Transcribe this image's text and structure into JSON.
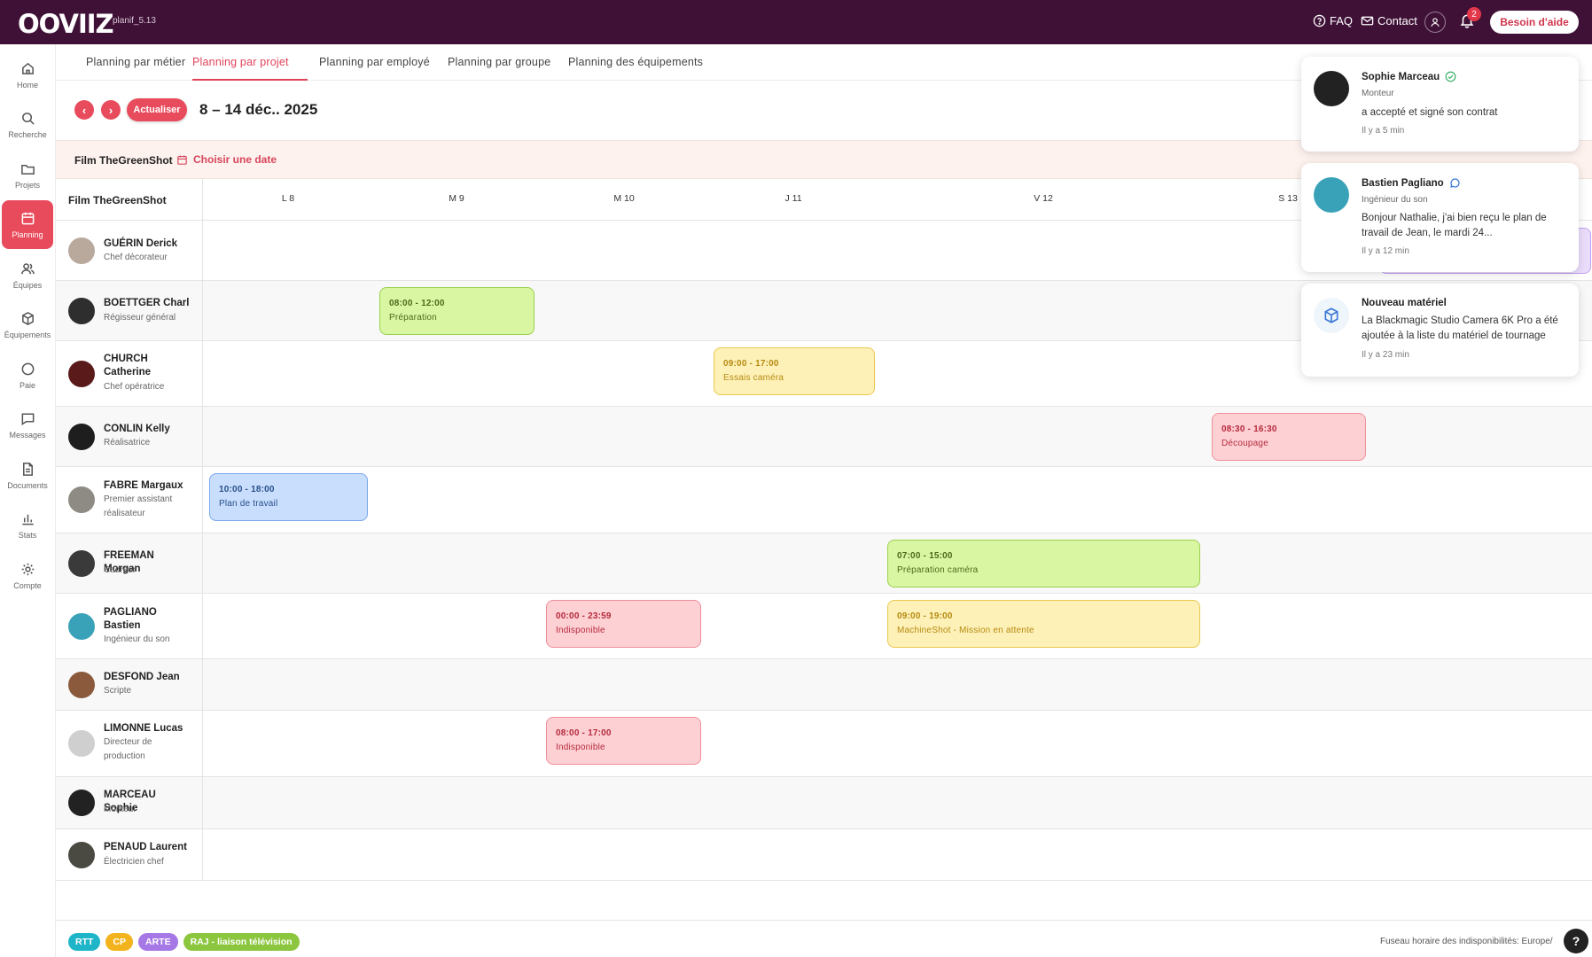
{
  "app": {
    "logo": "OOVIIZ",
    "version": "planif_5.13"
  },
  "topbar": {
    "faq": "FAQ",
    "contact": "Contact",
    "notif_count": "2",
    "help": "Besoin d'aide"
  },
  "nav": [
    {
      "label": "Home",
      "icon": "home-icon"
    },
    {
      "label": "Recherche",
      "icon": "search-icon"
    },
    {
      "label": "Projets",
      "icon": "folder-icon"
    },
    {
      "label": "Planning",
      "icon": "calendar-icon"
    },
    {
      "label": "Équipes",
      "icon": "users-icon"
    },
    {
      "label": "Équipements",
      "icon": "box-icon"
    },
    {
      "label": "Paie",
      "icon": "circle-icon"
    },
    {
      "label": "Messages",
      "icon": "message-icon"
    },
    {
      "label": "Documents",
      "icon": "document-icon"
    },
    {
      "label": "Stats",
      "icon": "chart-icon"
    },
    {
      "label": "Compte",
      "icon": "gear-icon"
    }
  ],
  "tabs": [
    {
      "label": "Planning par métier"
    },
    {
      "label": "Planning par projet"
    },
    {
      "label": "Planning par employé"
    },
    {
      "label": "Planning par groupe"
    },
    {
      "label": "Planning des équipements"
    }
  ],
  "toolbar": {
    "prev": "‹",
    "next": "›",
    "refresh": "Actualiser",
    "date_range": "8 – 14 déc.. 2025"
  },
  "project": {
    "name": "Film TheGreenShot",
    "choose_date": "Choisir une date"
  },
  "grid": {
    "corner": "Film TheGreenShot",
    "days": [
      "L 8",
      "M 9",
      "M 10",
      "J 11",
      "V 12",
      "S 13"
    ]
  },
  "employees": [
    {
      "name": "GUÉRIN Derick",
      "role": "Chef décorateur",
      "avatar_color": "#b9a89c"
    },
    {
      "name": "BOETTGER Charl",
      "role": "Régisseur général",
      "avatar_color": "#2e2e2e"
    },
    {
      "name": "CHURCH Catherine",
      "role": "Chef opératrice",
      "avatar_color": "#5a1a1a"
    },
    {
      "name": "CONLIN Kelly",
      "role": "Réalisatrice",
      "avatar_color": "#1e1e1e"
    },
    {
      "name": "FABRE Margaux",
      "role": "Premier assistant réalisateur",
      "avatar_color": "#8e8a84"
    },
    {
      "name": "FREEMAN Morgan",
      "role": "Cadreur",
      "avatar_color": "#3a3a3a"
    },
    {
      "name": "PAGLIANO Bastien",
      "role": "Ingénieur du son",
      "avatar_color": "#3aa2b8"
    },
    {
      "name": "DESFOND Jean",
      "role": "Scripte",
      "avatar_color": "#8b5a3c"
    },
    {
      "name": "LIMONNE Lucas",
      "role": "Directeur de production",
      "avatar_color": "#cfcfcf"
    },
    {
      "name": "MARCEAU Sophie",
      "role": "Monteur",
      "avatar_color": "#222222"
    },
    {
      "name": "PENAUD Laurent",
      "role": "Électricien chef",
      "avatar_color": "#4a4a42"
    }
  ],
  "events": [
    {
      "time": "08:00 - 12:00",
      "label": "Préparation"
    },
    {
      "time": "09:00 - 17:00",
      "label": "Essais caméra"
    },
    {
      "time": "08:30 - 16:30",
      "label": "Découpage"
    },
    {
      "time": "10:00 - 18:00",
      "label": "Plan de travail"
    },
    {
      "time": "07:00 - 15:00",
      "label": "Préparation caméra"
    },
    {
      "time": "00:00 - 23:59",
      "label": "Indisponible"
    },
    {
      "time": "09:00 - 19:00",
      "label": "MachineShot - Mission en attente"
    },
    {
      "time": "08:00 - 17:00",
      "label": "Indisponible"
    }
  ],
  "legend": [
    {
      "label": "RTT",
      "color": "#1fb5c9"
    },
    {
      "label": "CP",
      "color": "#f2b31c"
    },
    {
      "label": "ARTE",
      "color": "#a678e6"
    },
    {
      "label": "RAJ - liaison télévision",
      "color": "#8cc63f"
    }
  ],
  "footer": {
    "timezone": "Fuseau horaire des indisponibilités: Europe/",
    "help": "?"
  },
  "notifications": [
    {
      "title": "Sophie Marceau",
      "subtitle": "Monteur",
      "body": "a accepté et signé son contrat",
      "time": "Il y a 5 min",
      "icon": "check-circle-icon"
    },
    {
      "title": "Bastien Pagliano",
      "subtitle": "Ingénieur du son",
      "body": "Bonjour Nathalie, j'ai bien reçu le plan de travail de Jean, le mardi 24...",
      "time": "Il y a 12 min",
      "icon": "chat-bubble-icon"
    },
    {
      "title": "Nouveau matériel",
      "body": "La Blackmagic Studio Camera 6K Pro a été ajoutée à la liste du matériel de tournage",
      "time": "Il y a 23 min",
      "icon": "box-icon"
    }
  ]
}
